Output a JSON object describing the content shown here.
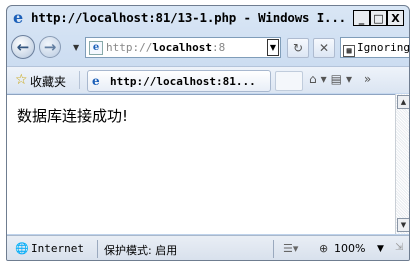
{
  "window": {
    "title": "http://localhost:81/13-1.php - Windows I...",
    "minimize": "_",
    "maximize": "□",
    "close": "X"
  },
  "nav": {
    "address_prefix": "http://",
    "address_host": "localhost",
    "address_suffix": ":8",
    "search_text": "Ignoring que"
  },
  "favorites": {
    "label": "收藏夹",
    "tab_title": "http://localhost:81..."
  },
  "content": {
    "message": "数据库连接成功!"
  },
  "status": {
    "zone": "Internet",
    "protected_mode": "保护模式: 启用",
    "zoom": "100%"
  }
}
